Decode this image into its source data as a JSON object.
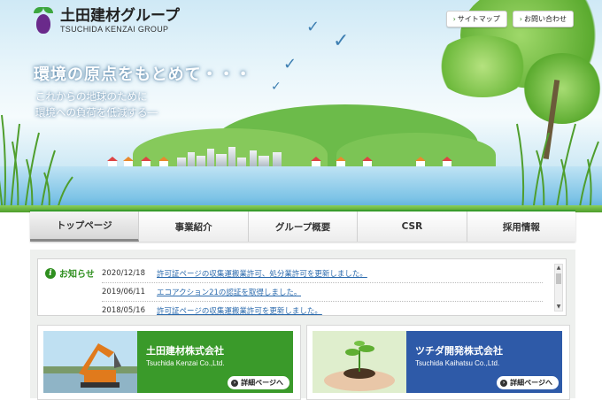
{
  "brand": {
    "name_jp": "土田建材グループ",
    "name_en": "TSUCHIDA KENZAI GROUP"
  },
  "top_links": [
    {
      "label": "サイトマップ"
    },
    {
      "label": "お問い合わせ"
    }
  ],
  "hero": {
    "catch": "環境の原点をもとめて・・・",
    "sub_line1": "これからの地球のために",
    "sub_line2": "環境への負荷を低減する―"
  },
  "nav": {
    "items": [
      {
        "label": "トップページ"
      },
      {
        "label": "事業紹介"
      },
      {
        "label": "グループ概要"
      },
      {
        "label": "CSR"
      },
      {
        "label": "採用情報"
      }
    ]
  },
  "news": {
    "title": "お知らせ",
    "items": [
      {
        "date": "2020/12/18",
        "text": "許可証ページの収集運搬業許可、処分業許可を更新しました。"
      },
      {
        "date": "2019/06/11",
        "text": "エコアクション21の認証を取得しました。"
      },
      {
        "date": "2018/05/16",
        "text": "許可証ページの収集運搬業許可を更新しました。"
      }
    ]
  },
  "companies": [
    {
      "name": "土田建材株式会社",
      "name_en": "Tsuchida Kenzai Co.,Ltd.",
      "button": "詳細ページへ",
      "color": "#3a9a2a"
    },
    {
      "name": "ツチダ開発株式会社",
      "name_en": "Tsuchida Kaihatsu Co.,Ltd.",
      "button": "詳細ページへ",
      "color": "#2e5aa8"
    }
  ],
  "colors": {
    "accent_green": "#3a9d2d",
    "link_blue": "#2a6aad"
  },
  "icons": {
    "logo": "leaf-bulb-logo",
    "info": "info-icon",
    "arrow": "chevron-right-icon"
  }
}
